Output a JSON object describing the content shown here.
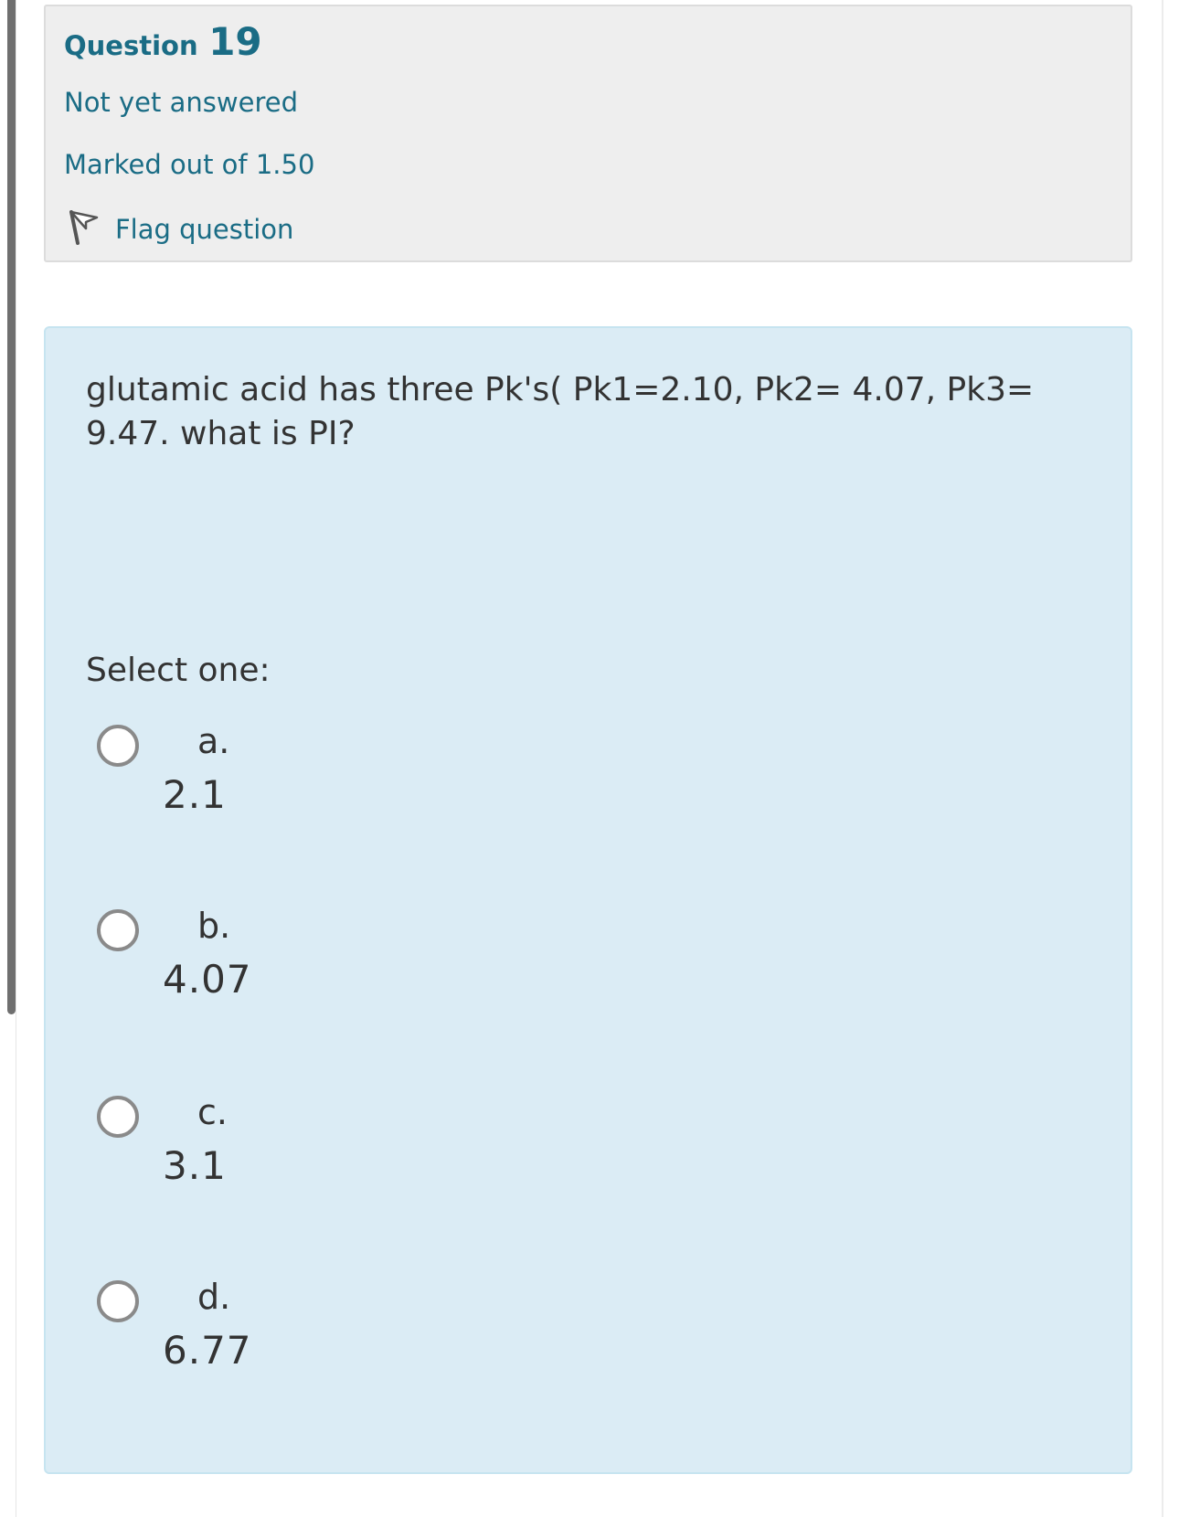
{
  "question": {
    "label": "Question",
    "number": "19",
    "state": "Not yet answered",
    "grade": "Marked out of 1.50",
    "flag_label": "Flag question",
    "flag_icon": "flag-icon"
  },
  "content": {
    "text": "glutamic acid has three Pk's( Pk1=2.10, Pk2= 4.07, Pk3= 9.47. what is PI?",
    "prompt": "Select one:",
    "options": [
      {
        "letter": "a.",
        "value": "2.1",
        "selected": false
      },
      {
        "letter": "b.",
        "value": "4.07",
        "selected": false
      },
      {
        "letter": "c.",
        "value": "3.1",
        "selected": false
      },
      {
        "letter": "d.",
        "value": "6.77",
        "selected": false
      }
    ]
  },
  "colors": {
    "accent": "#1a6c85",
    "info_bg": "#eeeeee",
    "content_bg": "#dbecf5",
    "content_border": "#c6e4f0",
    "text": "#333333"
  }
}
